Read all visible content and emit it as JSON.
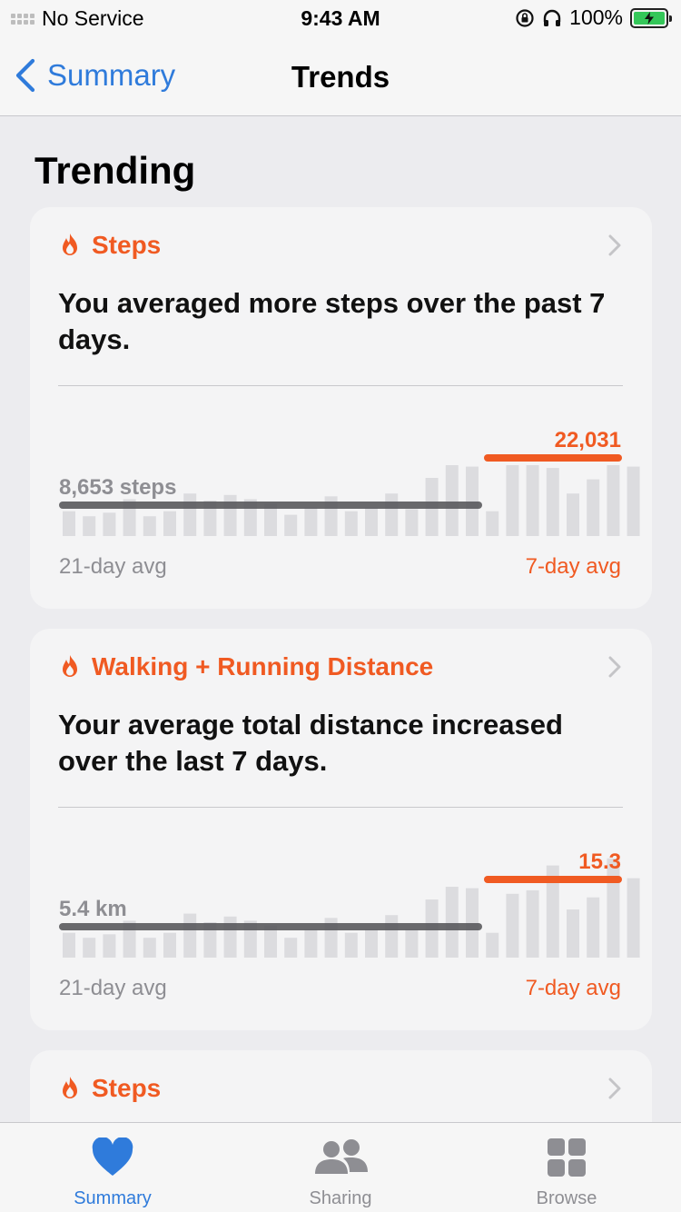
{
  "status_bar": {
    "carrier": "No Service",
    "time": "9:43 AM",
    "battery": "100%"
  },
  "nav": {
    "back_label": "Summary",
    "title": "Trends"
  },
  "section_title": "Trending",
  "colors": {
    "accent": "#f05a22",
    "link": "#2f7bdb",
    "bar_gray": "#dcdcdf",
    "avg_line": "#5a5a5e"
  },
  "cards": [
    {
      "category": "Steps",
      "message": "You averaged more steps over the past 7 days.",
      "avg21_value": "8,653 steps",
      "avg21_label": "21-day avg",
      "avg7_value": "22,031",
      "avg7_label": "7-day avg",
      "bars21": [
        0.35,
        0.28,
        0.33,
        0.52,
        0.28,
        0.35,
        0.6,
        0.5,
        0.58,
        0.52,
        0.45,
        0.3,
        0.4,
        0.56,
        0.35,
        0.4,
        0.6,
        0.38,
        0.82,
        1.0,
        0.98,
        0.35
      ],
      "bars7": [
        1.0,
        1.0,
        0.96,
        0.6,
        0.8,
        1.0,
        0.98
      ]
    },
    {
      "category": "Walking + Running Distance",
      "message": "Your average total distance increased over the last 7 days.",
      "avg21_value": "5.4 km",
      "avg21_label": "21-day avg",
      "avg7_value": "15.3",
      "avg7_label": "7-day avg",
      "bars21": [
        0.35,
        0.28,
        0.33,
        0.52,
        0.28,
        0.35,
        0.62,
        0.5,
        0.58,
        0.52,
        0.45,
        0.28,
        0.4,
        0.56,
        0.35,
        0.4,
        0.6,
        0.4,
        0.82,
        1.0,
        0.98,
        0.35
      ],
      "bars7": [
        0.9,
        0.95,
        1.3,
        0.68,
        0.85,
        1.4,
        1.12
      ]
    },
    {
      "category": "Steps"
    }
  ],
  "tabs": [
    {
      "label": "Summary",
      "icon": "heart-icon"
    },
    {
      "label": "Sharing",
      "icon": "people-icon"
    },
    {
      "label": "Browse",
      "icon": "grid-icon"
    }
  ]
}
